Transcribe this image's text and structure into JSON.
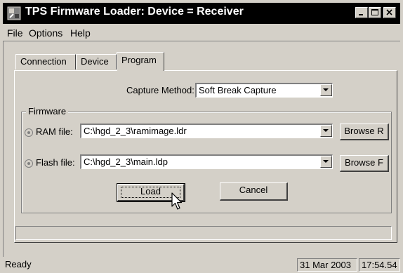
{
  "window": {
    "title": "TPS Firmware Loader:  Device = Receiver"
  },
  "menu": [
    "File",
    "Options",
    "Help"
  ],
  "tabs": [
    {
      "label": "Connection",
      "active": false
    },
    {
      "label": "Device",
      "active": false
    },
    {
      "label": "Program",
      "active": true
    }
  ],
  "capture": {
    "label": "Capture Method:",
    "value": "Soft Break Capture"
  },
  "firmware": {
    "group_label": "Firmware",
    "ram": {
      "label": "RAM file:",
      "value": "C:\\hgd_2_3\\ramimage.ldr",
      "browse_label": "Browse R"
    },
    "flash": {
      "label": "Flash file:",
      "value": "C:\\hgd_2_3\\main.ldp",
      "browse_label": "Browse F"
    }
  },
  "actions": {
    "load_label": "Load",
    "cancel_label": "Cancel"
  },
  "progress": {
    "percent": 0
  },
  "status": {
    "text": "Ready",
    "date": "31 Mar 2003",
    "time": "17:54.54"
  },
  "colors": {
    "title_bar": "#000000",
    "face": "#d4d0c8",
    "progress": "#0a246a"
  }
}
